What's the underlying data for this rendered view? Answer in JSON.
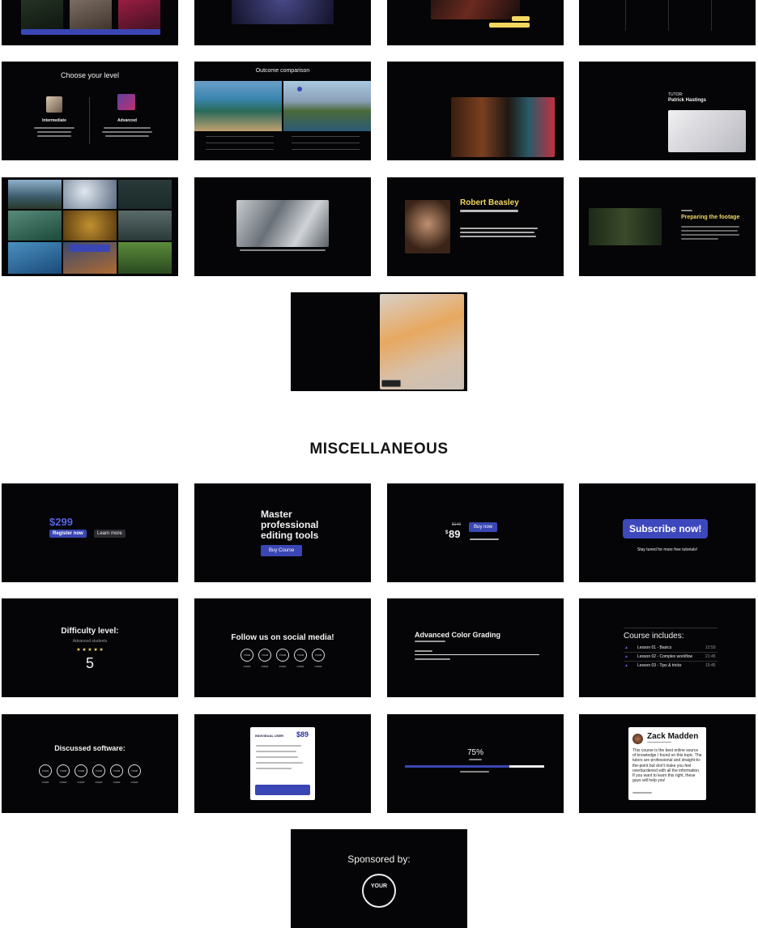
{
  "top_row": {
    "t1": {
      "captions": [
        "",
        "",
        ""
      ]
    },
    "t3": {
      "badge_top": "",
      "badge_bottom": ""
    }
  },
  "row2": {
    "level": {
      "title": "Choose your level",
      "left": "Intermediate",
      "right": "Advanced"
    },
    "outcome": {
      "title": "Outcome comparison"
    },
    "tutor": {
      "label": "TUTOR:",
      "name": "Patrick Hastings"
    }
  },
  "row3": {
    "grid_button": "",
    "robert": {
      "name": "Robert Beasley",
      "role": ""
    },
    "footage": {
      "title": "Preparing the footage"
    }
  },
  "row4": {
    "badge": ""
  },
  "section": {
    "title": "MISCELLANEOUS"
  },
  "misc": {
    "price": {
      "amount": "$299",
      "register": "Register now",
      "learn": "Learn more"
    },
    "master": {
      "line1": "Master",
      "line2": "professional",
      "line3": "editing tools",
      "button": "Buy Course"
    },
    "discount": {
      "old": "$149",
      "currency": "$",
      "price": "89",
      "button": "Buy now"
    },
    "subscribe": {
      "button": "Subscribe now!",
      "note": "Stay tuned for more free tutorials!"
    },
    "difficulty": {
      "title": "Difficulty level:",
      "subtitle": "Advanced students",
      "stars": "★ ★ ★ ★ ★",
      "value": "5"
    },
    "social": {
      "title": "Follow us on social media!",
      "logos": [
        "YOUR LOGO",
        "YOUR LOGO",
        "YOUR LOGO",
        "YOUR LOGO",
        "YOUR LOGO"
      ]
    },
    "color": {
      "title": "Advanced Color Grading"
    },
    "course": {
      "title": "Course includes:",
      "lessons": [
        {
          "label": "Lesson 01 - Basics",
          "time": "12:50"
        },
        {
          "label": "Lesson 02 - Complex workflow",
          "time": "21:45"
        },
        {
          "label": "Lesson 03 - Tips & tricks",
          "time": "15:45"
        }
      ]
    },
    "software": {
      "title": "Discussed software:",
      "logos": [
        "YOUR LOGO",
        "YOUR LOGO",
        "YOUR LOGO",
        "YOUR LOGO",
        "YOUR LOGO",
        "YOUR LOGO"
      ]
    },
    "plan": {
      "label": "INDIVIDUAL USER",
      "price": "$89"
    },
    "progress": {
      "value": "75%",
      "fraction": 0.75
    },
    "review": {
      "name": "Zack Madden",
      "body": "This course is the best online source of knowledge I found on this topic. The tutors are professional and straight-to-the-point but don't make you feel overburdened with all the information. If you want to learn this right, these guys will help you!"
    },
    "sponsor": {
      "title": "Sponsored by:",
      "logo": "YOUR"
    }
  },
  "colors": {
    "accent": "#3a46b4",
    "gold": "#f3d75f",
    "tile_bg": "#050507"
  }
}
